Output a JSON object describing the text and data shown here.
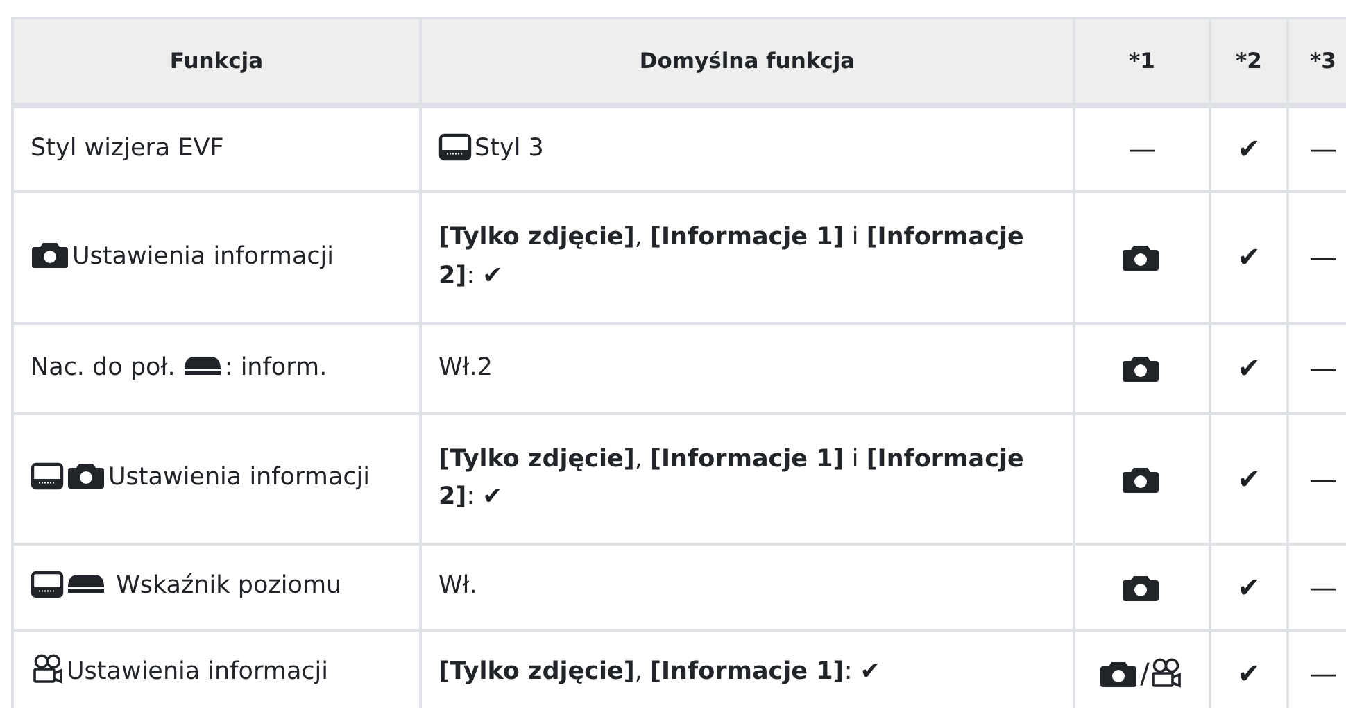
{
  "table": {
    "columns": [
      "Funkcja",
      "Domyślna funkcja",
      "*1",
      "*2",
      "*3"
    ],
    "rows": [
      {
        "function": [
          {
            "kind": "text",
            "text": "Styl wizjera EVF"
          }
        ],
        "default": [
          {
            "kind": "monitor"
          },
          {
            "kind": "text",
            "text": "Styl 3"
          }
        ],
        "col1": [
          {
            "kind": "text",
            "text": "—"
          }
        ],
        "col2": [
          {
            "kind": "text",
            "text": "✔"
          }
        ],
        "col3": [
          {
            "kind": "text",
            "text": "—"
          }
        ]
      },
      {
        "function": [
          {
            "kind": "camera"
          },
          {
            "kind": "text",
            "text": "Ustawienia informacji"
          }
        ],
        "default": [
          {
            "kind": "text",
            "text": "**[Tylko zdjęcie]**, **[Informacje 1]** i **[Informacje 2]**: ✔"
          }
        ],
        "col1": [
          {
            "kind": "camera"
          }
        ],
        "col2": [
          {
            "kind": "text",
            "text": "✔"
          }
        ],
        "col3": [
          {
            "kind": "text",
            "text": "—"
          }
        ]
      },
      {
        "function": [
          {
            "kind": "text",
            "text": "Nac. do poł. "
          },
          {
            "kind": "level"
          },
          {
            "kind": "text",
            "text": ": inform."
          }
        ],
        "default": [
          {
            "kind": "text",
            "text": "Wł.2"
          }
        ],
        "col1": [
          {
            "kind": "camera"
          }
        ],
        "col2": [
          {
            "kind": "text",
            "text": "✔"
          }
        ],
        "col3": [
          {
            "kind": "text",
            "text": "—"
          }
        ]
      },
      {
        "function": [
          {
            "kind": "monitor"
          },
          {
            "kind": "camera"
          },
          {
            "kind": "text",
            "text": "Ustawienia informacji"
          }
        ],
        "default": [
          {
            "kind": "text",
            "text": "**[Tylko zdjęcie]**, **[Informacje 1]** i **[Informacje 2]**: ✔"
          }
        ],
        "col1": [
          {
            "kind": "camera"
          }
        ],
        "col2": [
          {
            "kind": "text",
            "text": "✔"
          }
        ],
        "col3": [
          {
            "kind": "text",
            "text": "—"
          }
        ]
      },
      {
        "function": [
          {
            "kind": "monitor"
          },
          {
            "kind": "level"
          },
          {
            "kind": "text",
            "text": " Wskaźnik poziomu"
          }
        ],
        "default": [
          {
            "kind": "text",
            "text": "Wł."
          }
        ],
        "col1": [
          {
            "kind": "camera"
          }
        ],
        "col2": [
          {
            "kind": "text",
            "text": "✔"
          }
        ],
        "col3": [
          {
            "kind": "text",
            "text": "—"
          }
        ]
      },
      {
        "function": [
          {
            "kind": "movie"
          },
          {
            "kind": "text",
            "text": "Ustawienia informacji"
          }
        ],
        "default": [
          {
            "kind": "text",
            "text": "**[Tylko zdjęcie]**, **[Informacje 1]**: ✔"
          }
        ],
        "col1": [
          {
            "kind": "camera"
          },
          {
            "kind": "text",
            "text": "/"
          },
          {
            "kind": "movie"
          }
        ],
        "col2": [
          {
            "kind": "text",
            "text": "✔"
          }
        ],
        "col3": [
          {
            "kind": "text",
            "text": "—"
          }
        ]
      }
    ]
  }
}
